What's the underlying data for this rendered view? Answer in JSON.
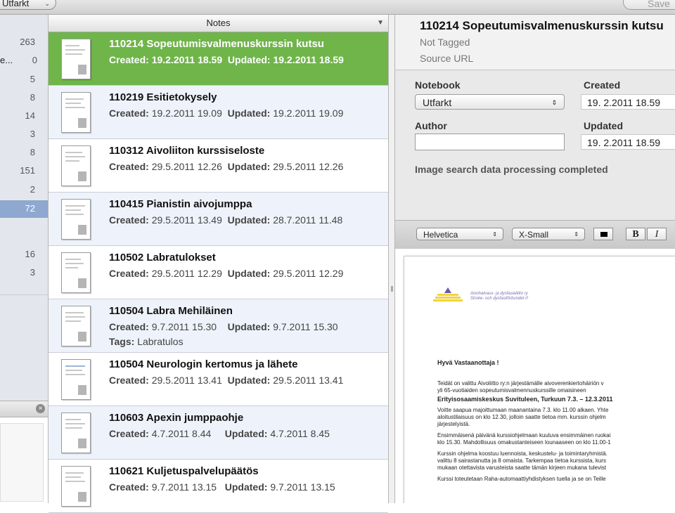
{
  "toolbar": {
    "notebook_popup": "Utfarkt",
    "save_label": "Save"
  },
  "sidebar": {
    "items": [
      {
        "label": "",
        "count": "263"
      },
      {
        "label": "e...",
        "count": "0"
      },
      {
        "label": "",
        "count": "5"
      },
      {
        "label": "",
        "count": "8"
      },
      {
        "label": "",
        "count": "14"
      },
      {
        "label": "",
        "count": "3"
      },
      {
        "label": "",
        "count": "8"
      },
      {
        "label": "",
        "count": "151"
      },
      {
        "label": "",
        "count": "2"
      },
      {
        "label": "",
        "count": "72"
      },
      {
        "label": "",
        "count": ""
      },
      {
        "label": "",
        "count": "16"
      },
      {
        "label": "",
        "count": "3"
      }
    ]
  },
  "notes_list": {
    "header": "Notes",
    "created_label": "Created:",
    "updated_label": "Updated:",
    "tags_label": "Tags:",
    "notes": [
      {
        "title": "110214 Sopeutumisvalmenuskurssin kutsu",
        "created": "19.2.2011 18.59",
        "updated": "19.2.2011 18.59",
        "tags": ""
      },
      {
        "title": "110219 Esitietokysely",
        "created": "19.2.2011 19.09",
        "updated": "19.2.2011 19.09",
        "tags": ""
      },
      {
        "title": "110312 Aivoliiton kurssiseloste",
        "created": "29.5.2011 12.26",
        "updated": "29.5.2011 12.26",
        "tags": ""
      },
      {
        "title": "110415 Pianistin aivojumppa",
        "created": "29.5.2011 13.49",
        "updated": "28.7.2011 11.48",
        "tags": ""
      },
      {
        "title": "110502 Labratulokset",
        "created": "29.5.2011 12.29",
        "updated": "29.5.2011 12.29",
        "tags": ""
      },
      {
        "title": "110504 Labra Mehiläinen",
        "created": "9.7.2011 15.30",
        "updated": "9.7.2011 15.30",
        "tags": "Labratulos"
      },
      {
        "title": "110504 Neurologin kertomus ja lähete",
        "created": "29.5.2011 13.41",
        "updated": "29.5.2011 13.41",
        "tags": ""
      },
      {
        "title": "110603 Apexin jumppaohje",
        "created": "4.7.2011 8.44",
        "updated": "4.7.2011 8.45",
        "tags": ""
      },
      {
        "title": "110621 Kuljetuspalvelupäätös",
        "created": "9.7.2011 13.15",
        "updated": "9.7.2011 13.15",
        "tags": ""
      }
    ]
  },
  "detail": {
    "title": "110214 Sopeutumisvalmenuskurssin kutsu",
    "tags": "Not Tagged",
    "source_url": "Source URL",
    "notebook_label": "Notebook",
    "notebook_value": "Utfarkt",
    "author_label": "Author",
    "author_value": "",
    "created_label": "Created",
    "created_value": "19. 2.2011 18.59",
    "updated_label": "Updated",
    "updated_value": "19. 2.2011 18.59",
    "status": "Image search data processing completed",
    "font": "Helvetica",
    "size": "X-Small",
    "bold": "B",
    "italic": "I"
  },
  "document": {
    "org_line1": "Aivohalvaus- ja dysfasialiitto ry",
    "org_line2": "Stroke- och dysfasiförbundet rf",
    "greeting": "Hyvä Vastaanottaja !",
    "p1a": "Teidät on valittu Aivoliitto ry:n järjestämälle aivoverenkiertohäiriön v",
    "p1b": "yli 65-vuotiaiden sopeutumisvalmennuskurssille omaisineen",
    "heading": "Erityisosaamiskeskus Suvituleen, Turkuun 7.3. – 12.3.2011",
    "p2a": "Voitte saapua majoittumaan maanantaina 7.3. klo 11.00 alkaen. Yhte",
    "p2b": "aloitustilaisuus on klo 12.30, jolloin saatte tietoa mm. kurssin ohjelm",
    "p2c": "järjestelyistä.",
    "p3a": "Ensimmäisenä päivänä kurssiohjelmaan kuuluva ensimmäinen ruokai",
    "p3b": "klo 15.30. Mahdollisuus omakustanteiseen lounaaseen on klo 11.00-1",
    "p4a": "Kurssin ohjelma koostuu luennoista, keskustelu- ja toimintaryhmistä.",
    "p4b": "valittu 8 sairastanutta ja 8 omaista. Tarkempaa tietoa kurssista, kurs",
    "p4c": "mukaan otettavista varusteista saatte tämän kirjeen mukana tulevist",
    "p5a": "Kurssi toteutetaan Raha-automaattiyhdistyksen tuella ja se on Teille"
  },
  "colors": {
    "selected_note": "#6fb54a",
    "selected_sidebar": "#8ea8cf",
    "alt_row": "#eef3fb"
  }
}
